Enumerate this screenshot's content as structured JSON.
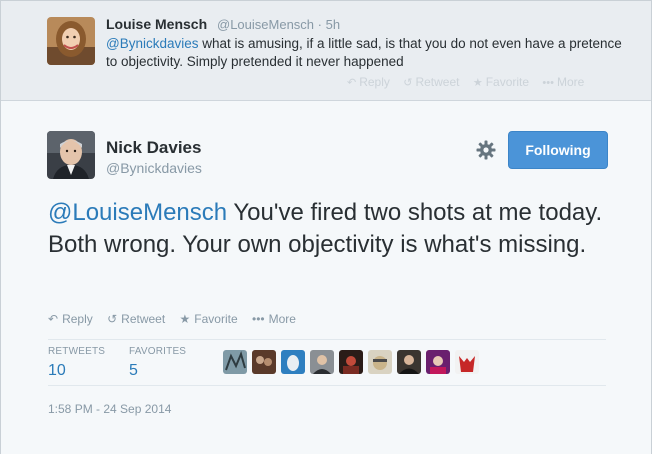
{
  "reply_tweet": {
    "name": "Louise Mensch",
    "handle": "@LouiseMensch",
    "separator": "·",
    "time": "5h",
    "mention": "@Bynickdavies",
    "text": " what is amusing, if a little sad, is that you do not even have a pretence to objectivity. Simply pretended it never happened",
    "actions": [
      {
        "icon": "reply-icon",
        "label": "Reply"
      },
      {
        "icon": "retweet-icon",
        "label": "Retweet"
      },
      {
        "icon": "star-icon",
        "label": "Favorite"
      },
      {
        "icon": "ellipsis-icon",
        "label": "More"
      }
    ]
  },
  "main_tweet": {
    "name": "Nick Davies",
    "handle": "@Bynickdavies",
    "follow_label": "Following",
    "mention": "@LouiseMensch",
    "text": " You've fired two shots at me today. Both wrong. Your own objectivity is what's missing.",
    "actions": [
      {
        "icon": "reply-icon",
        "label": "Reply"
      },
      {
        "icon": "retweet-icon",
        "label": "Retweet"
      },
      {
        "icon": "star-icon",
        "label": "Favorite"
      },
      {
        "icon": "ellipsis-icon",
        "label": "More"
      }
    ],
    "stats": {
      "retweets_label": "RETWEETS",
      "retweets_count": "10",
      "favorites_label": "FAVORITES",
      "favorites_count": "5"
    },
    "timestamp": "1:58 PM - 24 Sep 2014"
  },
  "colors": {
    "link": "#2b7bb9",
    "follow_button": "#4b94d8",
    "muted": "#8899a6"
  }
}
